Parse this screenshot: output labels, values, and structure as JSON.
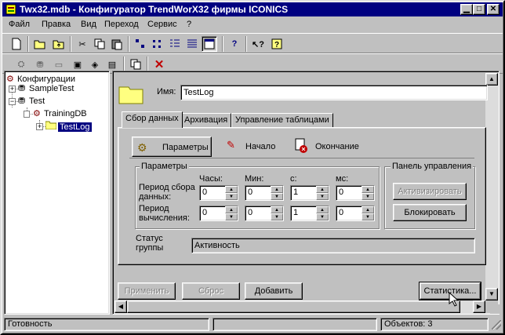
{
  "window": {
    "title": "Twx32.mdb - Конфигуратор TrendWorX32 фирмы ICONICS"
  },
  "menu": [
    {
      "label": "Файл"
    },
    {
      "label": "Правка"
    },
    {
      "label": "Вид"
    },
    {
      "label": "Переход"
    },
    {
      "label": "Сервис"
    },
    {
      "label": "?"
    }
  ],
  "tree": {
    "root": "Конфигурации",
    "sample": "SampleTest",
    "test": "Test",
    "db": "TrainingDB",
    "log": "TestLog"
  },
  "form": {
    "name_label": "Имя:",
    "name_value": "TestLog",
    "tabs": [
      "Сбор данных",
      "Архивация",
      "Управление таблицами"
    ],
    "subtabs": [
      "Параметры",
      "Начало",
      "Окончание"
    ],
    "params_group": "Параметры",
    "col_hours": "Часы:",
    "col_min": "Мин:",
    "col_sec": "с:",
    "col_ms": "мс:",
    "row1_label": "Период сбора данных:",
    "row2_label": "Период вычисления:",
    "row1": [
      "0",
      "0",
      "1",
      "0"
    ],
    "row2": [
      "0",
      "0",
      "1",
      "0"
    ],
    "panel_group": "Панель управления",
    "activate": "Активизировать",
    "block": "Блокировать",
    "status_label": "Статус группы",
    "status_value": "Активность"
  },
  "buttons": {
    "apply": "Применить",
    "reset": "Сброс",
    "add": "Добавить",
    "stats": "Статистика..."
  },
  "status": {
    "ready": "Готовность",
    "objects": "Объектов: 3"
  }
}
